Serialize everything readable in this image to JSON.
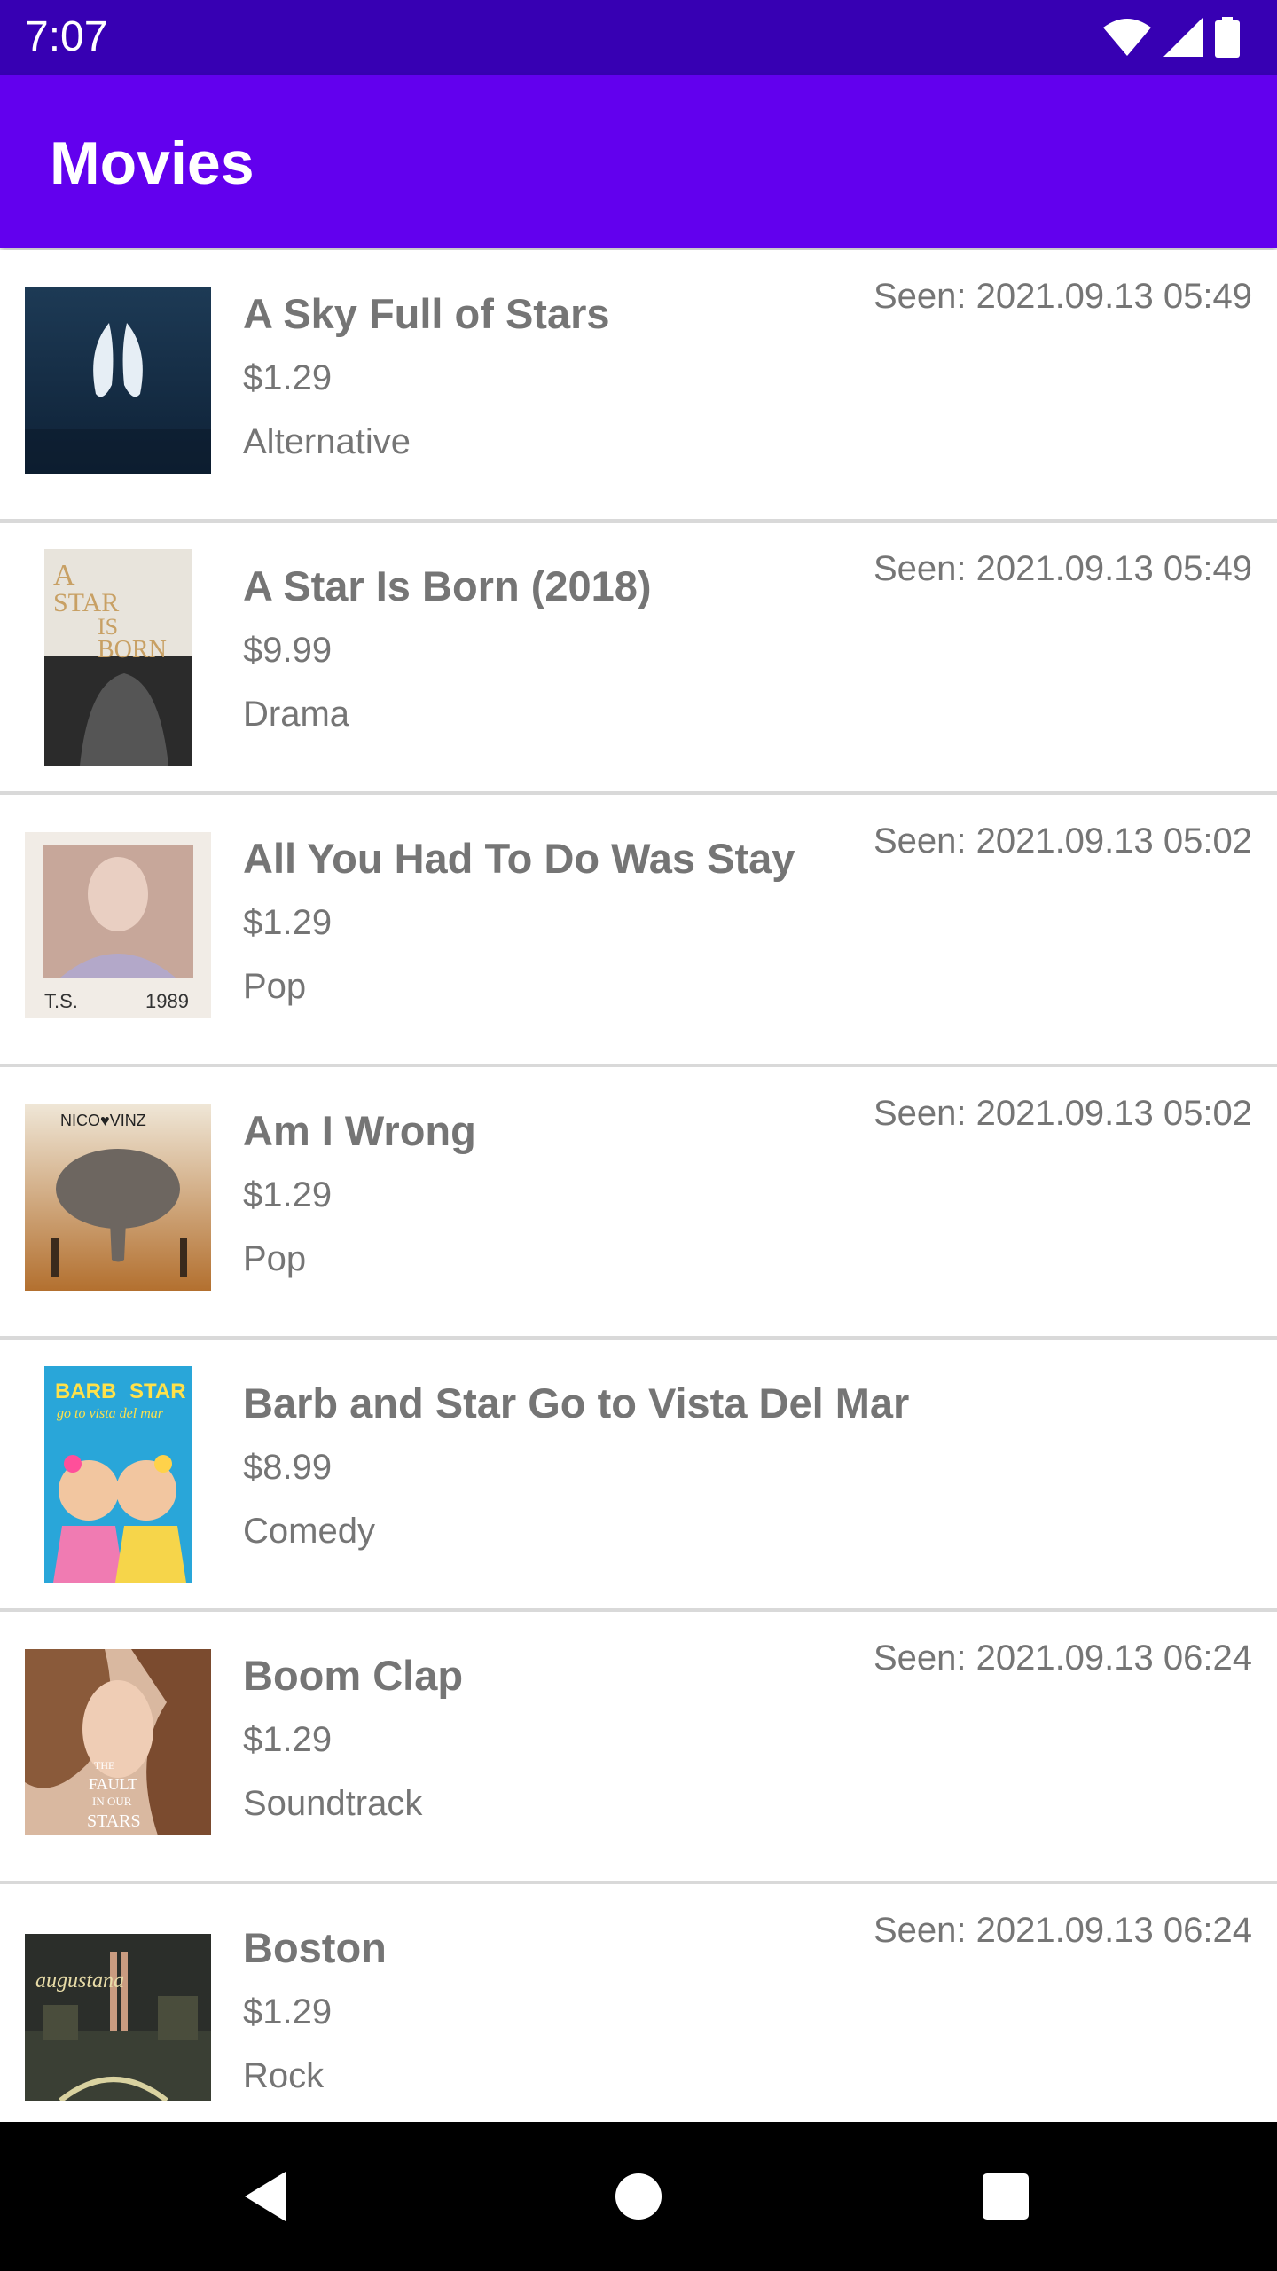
{
  "status_bar": {
    "time": "7:07",
    "icons": [
      "wifi-icon",
      "cellular-signal-icon",
      "battery-icon"
    ]
  },
  "app_bar": {
    "title": "Movies",
    "color": "#6200ee"
  },
  "movies": [
    {
      "title": "A Sky Full of Stars",
      "price": "$1.29",
      "genre": "Alternative",
      "seen": "Seen: 2021.09.13 05:49"
    },
    {
      "title": "A Star Is Born (2018)",
      "price": "$9.99",
      "genre": "Drama",
      "seen": "Seen: 2021.09.13 05:49"
    },
    {
      "title": "All You Had To Do Was Stay",
      "price": "$1.29",
      "genre": "Pop",
      "seen": "Seen: 2021.09.13 05:02"
    },
    {
      "title": "Am I Wrong",
      "price": "$1.29",
      "genre": "Pop",
      "seen": "Seen: 2021.09.13 05:02"
    },
    {
      "title": "Barb and Star Go to Vista Del Mar",
      "price": "$8.99",
      "genre": "Comedy",
      "seen": ""
    },
    {
      "title": "Boom Clap",
      "price": "$1.29",
      "genre": "Soundtrack",
      "seen": "Seen: 2021.09.13 06:24"
    },
    {
      "title": "Boston",
      "price": "$1.29",
      "genre": "Rock",
      "seen": "Seen: 2021.09.13 06:24"
    }
  ],
  "cover_text": {
    "star_is_born": [
      "A",
      "STAR",
      "IS",
      "BORN"
    ],
    "ts1989": [
      "T.S.",
      "1989"
    ],
    "nico_vinz": "NICO♥VINZ",
    "barb_star": [
      "BARB",
      "STAR",
      "go to vista del mar"
    ],
    "fault_stars": [
      "THE",
      "FAULT",
      "IN OUR",
      "STARS"
    ],
    "augustana": "augustana"
  },
  "nav_bar": {
    "icons": [
      "back-icon",
      "home-icon",
      "recents-icon"
    ]
  }
}
